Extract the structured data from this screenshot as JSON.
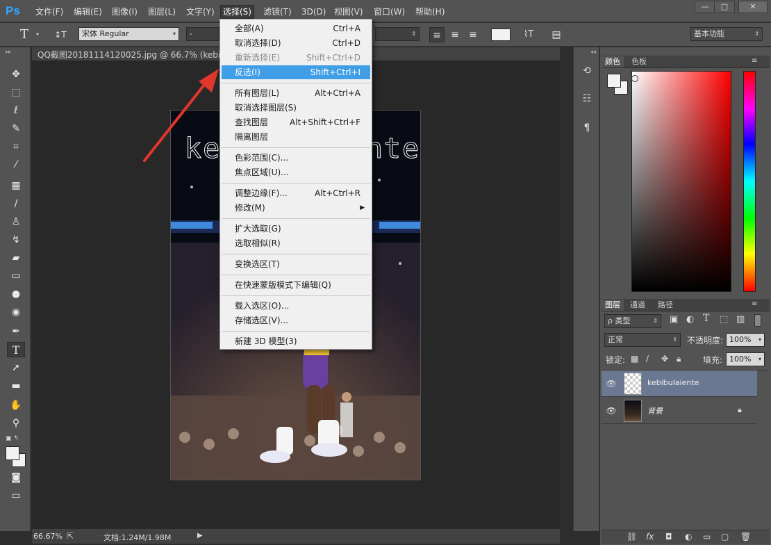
{
  "app": {
    "logo": "Ps"
  },
  "menubar": {
    "items": [
      "文件(F)",
      "编辑(E)",
      "图像(I)",
      "图层(L)",
      "文字(Y)",
      "选择(S)",
      "滤镜(T)",
      "3D(D)",
      "视图(V)",
      "窗口(W)",
      "帮助(H)"
    ],
    "active_index": 5
  },
  "window_controls": {
    "minimize": "—",
    "restore": "□",
    "close": "✕"
  },
  "options_bar": {
    "tool_glyph": "T",
    "orient_glyph": "↕T",
    "font_family": "宋体 Regular",
    "font_style": "-",
    "workspace": "基本功能"
  },
  "document": {
    "tab_title": "QQ截图20181114120025.jpg @ 66.7% (kebibula",
    "text_layer_content": "kebibulaiente",
    "zoom": "66.67%",
    "doc_info": "文档:1.24M/1.98M"
  },
  "select_menu": {
    "groups": [
      [
        {
          "label": "全部(A)",
          "shortcut": "Ctrl+A"
        },
        {
          "label": "取消选择(D)",
          "shortcut": "Ctrl+D"
        },
        {
          "label": "重新选择(E)",
          "shortcut": "Shift+Ctrl+D",
          "disabled": true
        },
        {
          "label": "反选(I)",
          "shortcut": "Shift+Ctrl+I",
          "highlight": true
        }
      ],
      [
        {
          "label": "所有图层(L)",
          "shortcut": "Alt+Ctrl+A"
        },
        {
          "label": "取消选择图层(S)",
          "shortcut": ""
        },
        {
          "label": "查找图层",
          "shortcut": "Alt+Shift+Ctrl+F"
        },
        {
          "label": "隔离图层",
          "shortcut": ""
        }
      ],
      [
        {
          "label": "色彩范围(C)...",
          "shortcut": ""
        },
        {
          "label": "焦点区域(U)...",
          "shortcut": ""
        }
      ],
      [
        {
          "label": "调整边缘(F)...",
          "shortcut": "Alt+Ctrl+R"
        },
        {
          "label": "修改(M)",
          "shortcut": "",
          "submenu": true
        }
      ],
      [
        {
          "label": "扩大选取(G)",
          "shortcut": ""
        },
        {
          "label": "选取相似(R)",
          "shortcut": ""
        }
      ],
      [
        {
          "label": "变换选区(T)",
          "shortcut": ""
        }
      ],
      [
        {
          "label": "在快速蒙版模式下编辑(Q)",
          "shortcut": ""
        }
      ],
      [
        {
          "label": "载入选区(O)...",
          "shortcut": ""
        },
        {
          "label": "存储选区(V)...",
          "shortcut": ""
        }
      ],
      [
        {
          "label": "新建 3D 模型(3)",
          "shortcut": ""
        }
      ]
    ]
  },
  "color_panel": {
    "tabs": [
      "颜色",
      "色板"
    ],
    "active_tab": 0
  },
  "layers_panel": {
    "tabs": [
      "图层",
      "通道",
      "路径"
    ],
    "active_tab": 0,
    "filter_label": "ρ 类型",
    "blend_mode": "正常",
    "opacity_label": "不透明度:",
    "opacity_value": "100%",
    "lock_label": "锁定:",
    "fill_label": "填充:",
    "fill_value": "100%",
    "layers": [
      {
        "name": "kebibulaiente",
        "selected": true,
        "locked": false
      },
      {
        "name": "背景",
        "selected": false,
        "locked": true
      }
    ]
  },
  "colors": {
    "accent_highlight": "#3f9ee6",
    "selected_layer": "#6b7891",
    "ps_logo": "#31a8ff",
    "arrow": "#e0362c"
  }
}
